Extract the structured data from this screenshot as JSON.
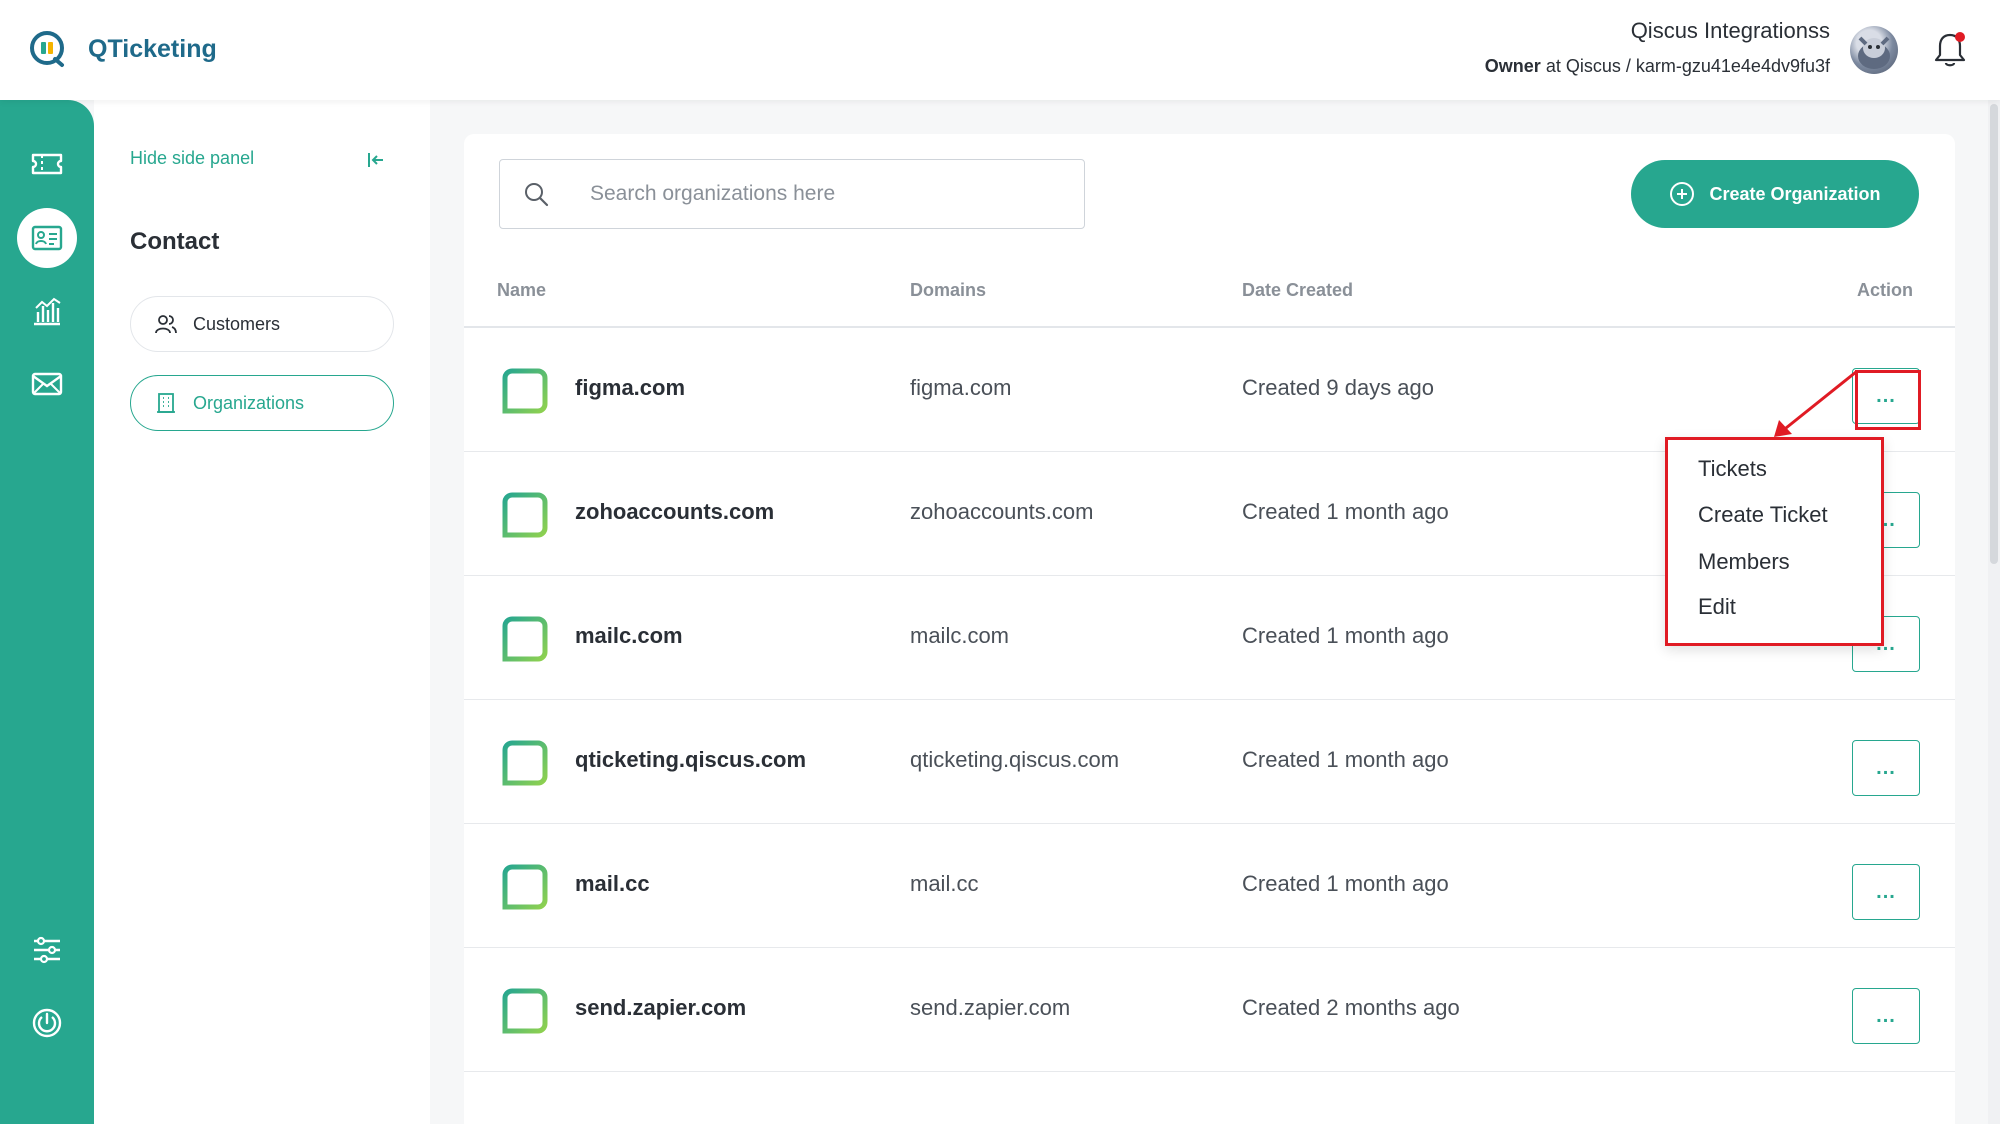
{
  "app": {
    "name": "QTicketing"
  },
  "user": {
    "name": "Qiscus Integrationss",
    "role": "Owner",
    "role_connector": "at",
    "workspace": "Qiscus / karm-gzu41e4e4dv9fu3f"
  },
  "rail": {
    "items": [
      {
        "icon": "ticket-icon"
      },
      {
        "icon": "contact-card-icon",
        "active": true
      },
      {
        "icon": "analytics-icon"
      },
      {
        "icon": "mail-icon"
      },
      {
        "icon": "settings-sliders-icon"
      },
      {
        "icon": "power-icon"
      }
    ]
  },
  "sidepanel": {
    "hide_label": "Hide side panel",
    "section_title": "Contact",
    "items": [
      {
        "label": "Customers",
        "icon": "users-icon",
        "active": false
      },
      {
        "label": "Organizations",
        "icon": "building-icon",
        "active": true
      }
    ]
  },
  "toolbar": {
    "search_placeholder": "Search organizations here",
    "create_label": "Create Organization"
  },
  "table": {
    "headers": {
      "name": "Name",
      "domains": "Domains",
      "date": "Date Created",
      "action": "Action"
    },
    "action_label": "...",
    "rows": [
      {
        "name": "figma.com",
        "domain": "figma.com",
        "date": "Created 9 days ago"
      },
      {
        "name": "zohoaccounts.com",
        "domain": "zohoaccounts.com",
        "date": "Created 1 month ago"
      },
      {
        "name": "mailc.com",
        "domain": "mailc.com",
        "date": "Created 1 month ago"
      },
      {
        "name": "qticketing.qiscus.com",
        "domain": "qticketing.qiscus.com",
        "date": "Created 1 month ago"
      },
      {
        "name": "mail.cc",
        "domain": "mail.cc",
        "date": "Created 1 month ago"
      },
      {
        "name": "send.zapier.com",
        "domain": "send.zapier.com",
        "date": "Created 2 months ago"
      }
    ]
  },
  "action_menu": {
    "items": [
      "Tickets",
      "Create Ticket",
      "Members",
      "Edit"
    ]
  },
  "colors": {
    "brand": "#27a78f",
    "brand_text": "#1f6a8a",
    "annotation": "#e01b24"
  }
}
